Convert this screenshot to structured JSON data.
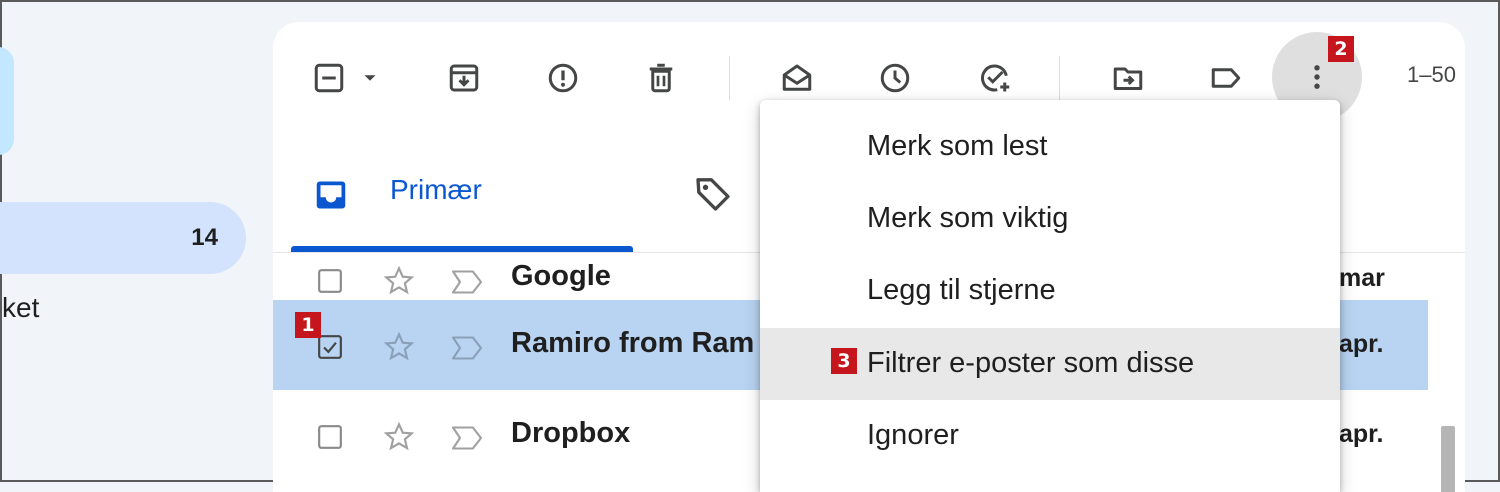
{
  "sidebar": {
    "inbox_count": "14",
    "partial_label": "ket"
  },
  "toolbar": {
    "icons": [
      "select-checkbox-icon",
      "dropdown-caret-icon",
      "archive-icon",
      "report-spam-icon",
      "delete-icon",
      "mark-read-icon",
      "snooze-icon",
      "add-task-icon",
      "move-to-icon",
      "label-icon",
      "more-vert-icon"
    ],
    "pagination": "1–50"
  },
  "tabs": {
    "primary_label": "Primær"
  },
  "emails": [
    {
      "sender": "Google",
      "date": "mar",
      "selected": false
    },
    {
      "sender": "Ramiro from Ram",
      "date": "apr.",
      "selected": true
    },
    {
      "sender": "Dropbox",
      "date": "apr.",
      "selected": false
    }
  ],
  "menu": {
    "items": [
      "Merk som lest",
      "Merk som viktig",
      "Legg til stjerne",
      "Filtrer e-poster som disse",
      "Ignorer"
    ],
    "hovered_index": 3
  },
  "badges": {
    "step1": "1",
    "step2": "2",
    "step3": "3"
  },
  "colors": {
    "accent_blue": "#0b57d0",
    "selected_row": "#b8d4f2",
    "inbox_highlight": "#d3e3fd",
    "badge_red": "#c4161c"
  }
}
